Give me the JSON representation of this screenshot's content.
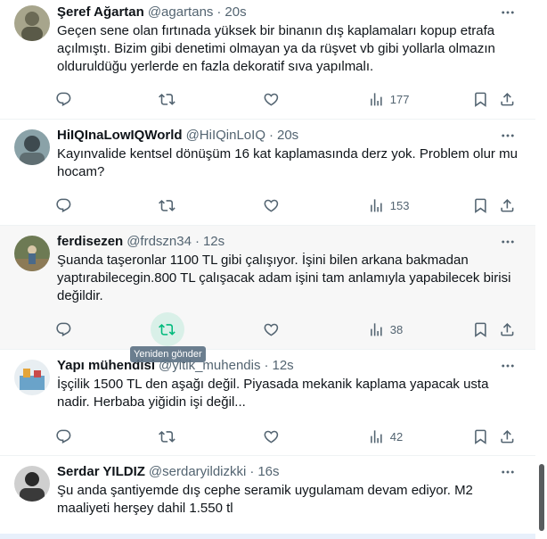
{
  "colors": {
    "accent_retweet": "#00ba7c",
    "muted": "#536471",
    "text": "#0f1419"
  },
  "tooltip": "Yeniden gönder",
  "tweets": [
    {
      "name": "Şeref Ağartan",
      "handle": "@agartans",
      "time": "20s",
      "text": "Geçen sene olan fırtınada yüksek bir binanın dış kaplamaları kopup etrafa açılmıştı. Bizim gibi denetimi olmayan ya da rüşvet vb gibi yollarla olmazın olduruldüğu yerlerde en fazla dekoratif sıva yapılmalı.",
      "views": "177"
    },
    {
      "name": "HiIQInaLowIQWorld",
      "handle": "@HiIQinLoIQ",
      "time": "20s",
      "text": "Kayınvalide kentsel dönüşüm 16 kat kaplamasında derz yok. Problem olur mu hocam?",
      "views": "153"
    },
    {
      "name": "ferdisezen",
      "handle": "@frdszn34",
      "time": "12s",
      "text": "Şuanda taşeronlar 1100 TL gibi çalışıyor. İşini bilen arkana bakmadan yaptırabilecegin.800 TL çalışacak adam işini tam anlamıyla yapabilecek birisi değildir.",
      "views": "38"
    },
    {
      "name": "Yapı mühendisi",
      "handle": "@yitik_muhendis",
      "time": "12s",
      "text": "İşçilik 1500 TL den aşağı değil. Piyasada mekanik kaplama yapacak usta nadir. Herbaba yiğidin işi değil...",
      "views": "42"
    },
    {
      "name": "Serdar YILDIZ",
      "handle": "@serdaryildizkki",
      "time": "16s",
      "text": "Şu anda şantiyemde dış cephe seramik uygulamam devam ediyor. M2 maaliyeti herşey dahil 1.550 tl",
      "views": ""
    }
  ]
}
